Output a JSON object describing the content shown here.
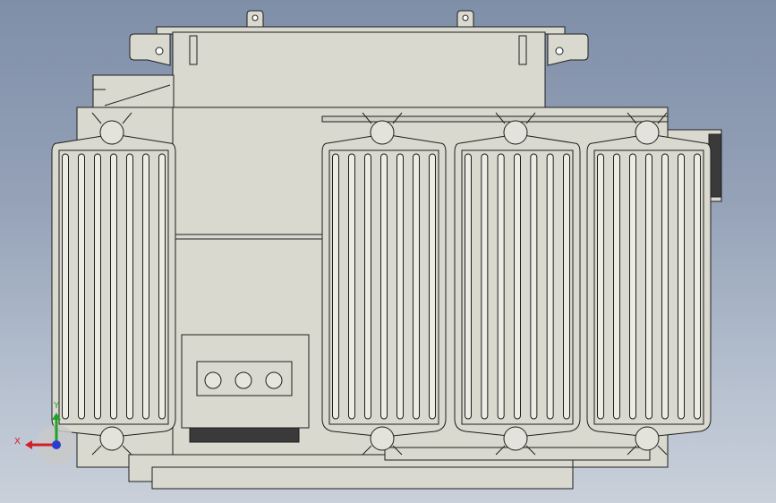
{
  "viewport": {
    "background_top": "#7f8fa8",
    "background_bottom": "#c9d0da"
  },
  "model": {
    "name": "",
    "body_color": "#d9d9cf",
    "line_color": "#1f1f1f",
    "radiator_groups": 4,
    "fins_per_radiator": 7,
    "terminal_holes": 3
  },
  "triad": {
    "x_label": "X",
    "y_label": "Y",
    "x_color": "#d0202a",
    "y_color": "#1fa32a",
    "z_color": "#2a3bd0"
  }
}
